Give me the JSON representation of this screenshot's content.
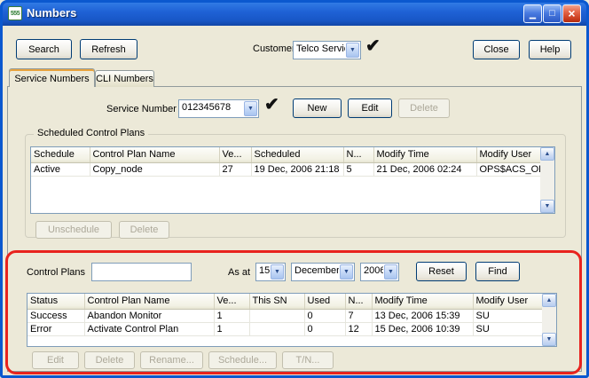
{
  "colors": {
    "annotation_red": "#E8231E",
    "titlebar_blue": "#1F62D6",
    "window_face": "#ECE9D8"
  },
  "icons": {
    "app": "555",
    "minimize": "▁",
    "maximize": "□",
    "close": "×",
    "dropdown": "▼",
    "check": "✔",
    "scroll_up": "▲",
    "scroll_down": "▼"
  },
  "window": {
    "title": "Numbers"
  },
  "toolbar": {
    "search": "Search",
    "refresh": "Refresh",
    "customer_label": "Customer",
    "customer_value": "Telco Services",
    "close": "Close",
    "help": "Help"
  },
  "tabs": {
    "service_numbers": "Service Numbers",
    "cli_numbers": "CLI Numbers"
  },
  "service_number": {
    "label": "Service Number",
    "value": "012345678",
    "new": "New",
    "edit": "Edit",
    "delete": "Delete"
  },
  "scheduled_plans": {
    "group_title": "Scheduled Control Plans",
    "columns": [
      "Schedule",
      "Control Plan Name",
      "Ve...",
      "Scheduled",
      "N...",
      "Modify Time",
      "Modify User"
    ],
    "rows": [
      [
        "Active",
        "Copy_node",
        "27",
        "19 Dec, 2006 21:18",
        "5",
        "21 Dec, 2006 02:24",
        "OPS$ACS_OPER"
      ]
    ],
    "unschedule": "Unschedule",
    "delete": "Delete"
  },
  "control_plans": {
    "label": "Control Plans",
    "filter_value": "",
    "as_at": "As at",
    "day": "15",
    "month": "December",
    "year": "2006",
    "reset": "Reset",
    "find": "Find",
    "columns": [
      "Status",
      "Control Plan Name",
      "Ve...",
      "This SN",
      "Used",
      "N...",
      "Modify Time",
      "Modify User"
    ],
    "rows": [
      [
        "Success",
        "Abandon Monitor",
        "1",
        "",
        "0",
        "7",
        "13 Dec, 2006 15:39",
        "SU"
      ],
      [
        "Error",
        "Activate Control Plan",
        "1",
        "",
        "0",
        "12",
        "15 Dec, 2006 10:39",
        "SU"
      ]
    ],
    "buttons": [
      "Edit",
      "Delete",
      "Rename...",
      "Schedule...",
      "T/N..."
    ]
  }
}
